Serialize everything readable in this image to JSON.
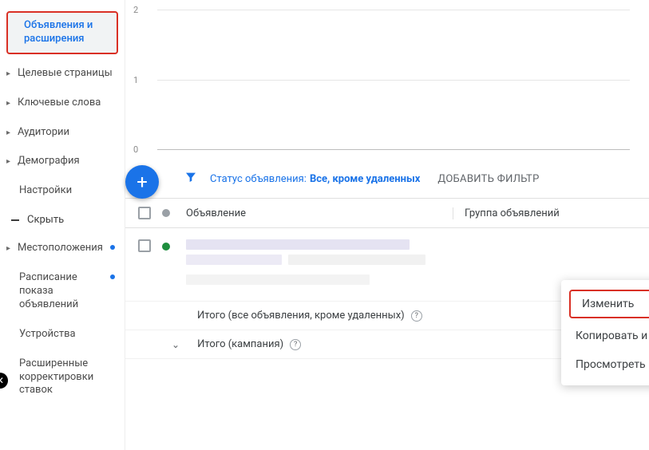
{
  "sidebar": {
    "items": [
      {
        "label": "Объявления и расширения",
        "chev": false,
        "active": true,
        "highlight": true
      },
      {
        "label": "Целевые страницы",
        "chev": true
      },
      {
        "label": "Ключевые слова",
        "chev": true
      },
      {
        "label": "Аудитории",
        "chev": true
      },
      {
        "label": "Демография",
        "chev": true
      },
      {
        "label": "Настройки",
        "chev": false
      }
    ],
    "collapse_label": "Скрыть",
    "lower": [
      {
        "label": "Местоположения",
        "chev": true,
        "dot": true
      },
      {
        "label": "Расписание показа объявлений",
        "chev": false,
        "dot": true
      },
      {
        "label": "Устройства",
        "chev": false
      },
      {
        "label": "Расширенные корректировки ставок",
        "chev": false
      }
    ]
  },
  "chart_data": {
    "type": "line",
    "y_ticks": [
      "2",
      "1",
      "0"
    ]
  },
  "filter": {
    "status_label": "Статус объявления:",
    "status_value": "Все, кроме удаленных",
    "add_filter": "ДОБАВИТЬ ФИЛЬТР"
  },
  "table": {
    "col_ad": "Объявление",
    "col_group": "Группа объявлений",
    "summary1": "Итого (все объявления, кроме удаленных)",
    "summary2": "Итого (кампания)"
  },
  "context_menu": {
    "edit": "Изменить",
    "copy_edit": "Копировать и изменить",
    "history": "Просмотреть историю версий"
  }
}
